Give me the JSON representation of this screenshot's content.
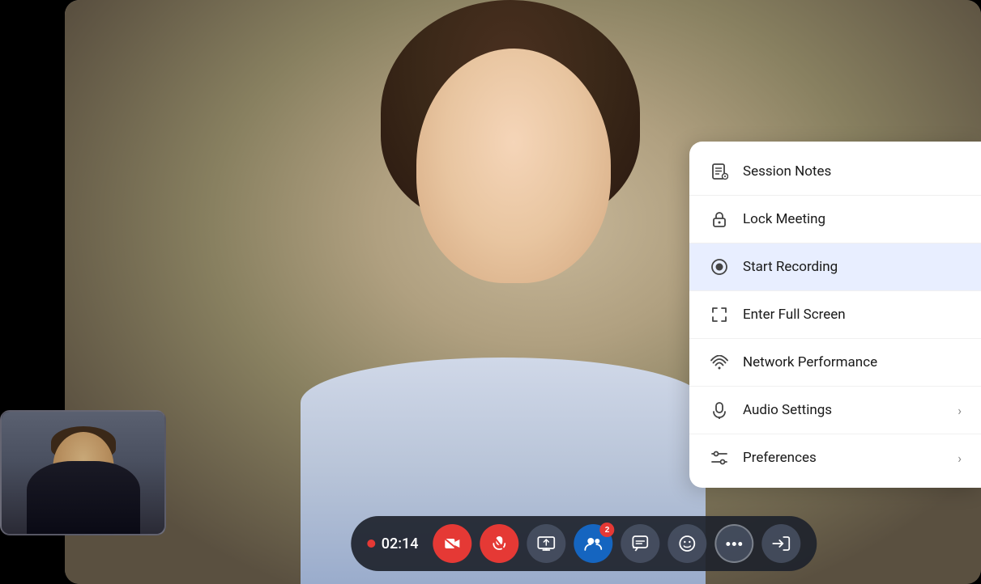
{
  "menu": {
    "items": [
      {
        "id": "session-notes",
        "label": "Session Notes",
        "icon": "notes-icon",
        "hasChevron": false,
        "active": false
      },
      {
        "id": "lock-meeting",
        "label": "Lock Meeting",
        "icon": "lock-icon",
        "hasChevron": false,
        "active": false
      },
      {
        "id": "start-recording",
        "label": "Start Recording",
        "icon": "record-icon",
        "hasChevron": false,
        "active": true
      },
      {
        "id": "enter-full-screen",
        "label": "Enter Full Screen",
        "icon": "fullscreen-icon",
        "hasChevron": false,
        "active": false
      },
      {
        "id": "network-performance",
        "label": "Network Performance",
        "icon": "wifi-icon",
        "hasChevron": false,
        "active": false
      },
      {
        "id": "audio-settings",
        "label": "Audio Settings",
        "icon": "audio-icon",
        "hasChevron": true,
        "active": false
      },
      {
        "id": "preferences",
        "label": "Preferences",
        "icon": "preferences-icon",
        "hasChevron": true,
        "active": false
      }
    ]
  },
  "toolbar": {
    "timer": "02:14",
    "participantBadge": "2",
    "buttons": [
      {
        "id": "video",
        "label": "Video",
        "icon": "camera-icon",
        "style": "red"
      },
      {
        "id": "mute",
        "label": "Mute",
        "icon": "mic-icon",
        "style": "red"
      },
      {
        "id": "share",
        "label": "Share Screen",
        "icon": "share-icon",
        "style": "dark"
      },
      {
        "id": "participants",
        "label": "Participants",
        "icon": "people-icon",
        "style": "blue",
        "badge": "2"
      },
      {
        "id": "chat",
        "label": "Chat",
        "icon": "chat-icon",
        "style": "dark"
      },
      {
        "id": "reactions",
        "label": "Reactions",
        "icon": "reaction-icon",
        "style": "dark"
      },
      {
        "id": "more",
        "label": "More",
        "icon": "more-icon",
        "style": "more"
      },
      {
        "id": "leave",
        "label": "Leave",
        "icon": "leave-icon",
        "style": "dark"
      }
    ]
  }
}
